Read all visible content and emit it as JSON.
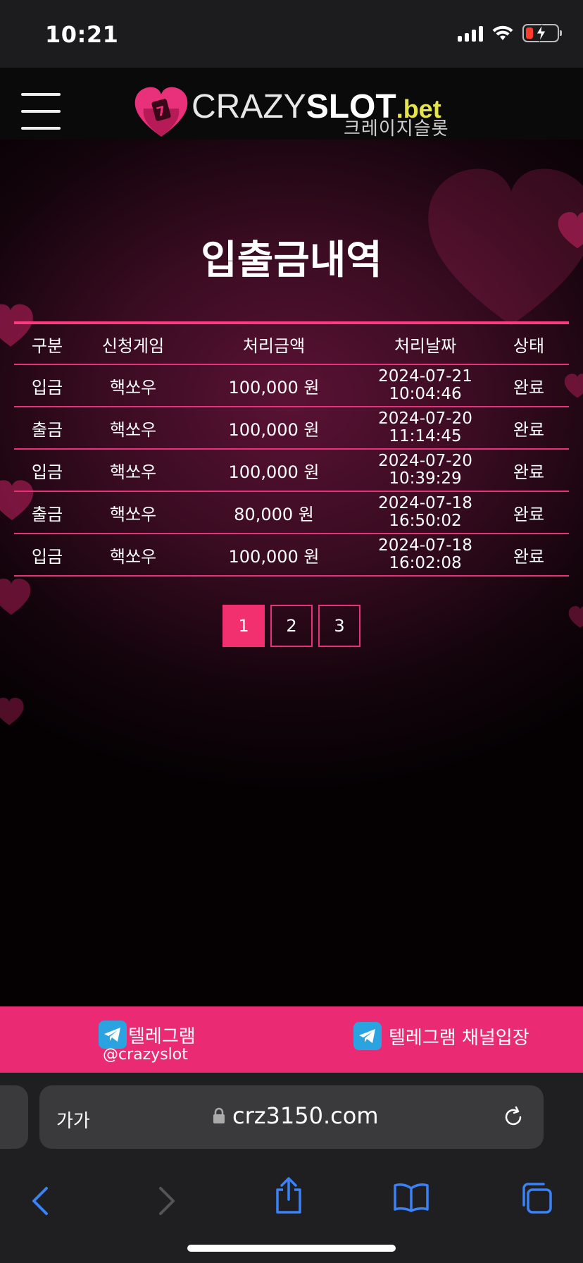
{
  "status_bar": {
    "time": "10:21"
  },
  "header": {
    "logo_crazy": "CRAZY",
    "logo_slot": "SLOT",
    "logo_bet": ".bet",
    "logo_korean": "크레이지슬롯"
  },
  "page_title": "입출금내역",
  "table": {
    "headers": [
      "구분",
      "신청게임",
      "처리금액",
      "처리날짜",
      "상태"
    ],
    "rows": [
      {
        "type": "입금",
        "game": "핵쏘우",
        "amount": "100,000 원",
        "date": "2024-07-21",
        "time": "10:04:46",
        "status": "완료"
      },
      {
        "type": "출금",
        "game": "핵쏘우",
        "amount": "100,000 원",
        "date": "2024-07-20",
        "time": "11:14:45",
        "status": "완료"
      },
      {
        "type": "입금",
        "game": "핵쏘우",
        "amount": "100,000 원",
        "date": "2024-07-20",
        "time": "10:39:29",
        "status": "완료"
      },
      {
        "type": "출금",
        "game": "핵쏘우",
        "amount": "80,000 원",
        "date": "2024-07-18",
        "time": "16:50:02",
        "status": "완료"
      },
      {
        "type": "입금",
        "game": "핵쏘우",
        "amount": "100,000 원",
        "date": "2024-07-18",
        "time": "16:02:08",
        "status": "완료"
      }
    ]
  },
  "pagination": {
    "pages": [
      "1",
      "2",
      "3"
    ],
    "current": "1"
  },
  "telegram": {
    "left_label": "텔레그램",
    "handle": "@crazyslot",
    "right_label": "텔레그램 채널입장"
  },
  "browser": {
    "text_size_label": "가가",
    "url": "crz3150.com"
  },
  "colors": {
    "accent": "#ea2b74",
    "table_line": "#e8317a",
    "bet_yellow": "#e7e34a"
  }
}
